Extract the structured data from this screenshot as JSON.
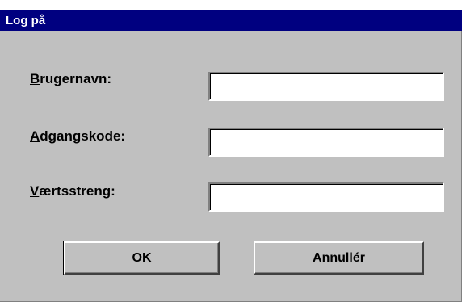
{
  "window": {
    "title": "Log på"
  },
  "form": {
    "username": {
      "accel": "B",
      "rest": "rugernavn:",
      "value": ""
    },
    "password": {
      "accel": "A",
      "rest": "dgangskode:",
      "value": ""
    },
    "host": {
      "accel": "V",
      "rest": "ærtsstreng:",
      "value": ""
    }
  },
  "buttons": {
    "ok_label": "OK",
    "cancel_label": "Annullér"
  },
  "colors": {
    "titlebar": "#000080",
    "dialog_face": "#c0c0c0",
    "field_bg": "#ffffff"
  }
}
